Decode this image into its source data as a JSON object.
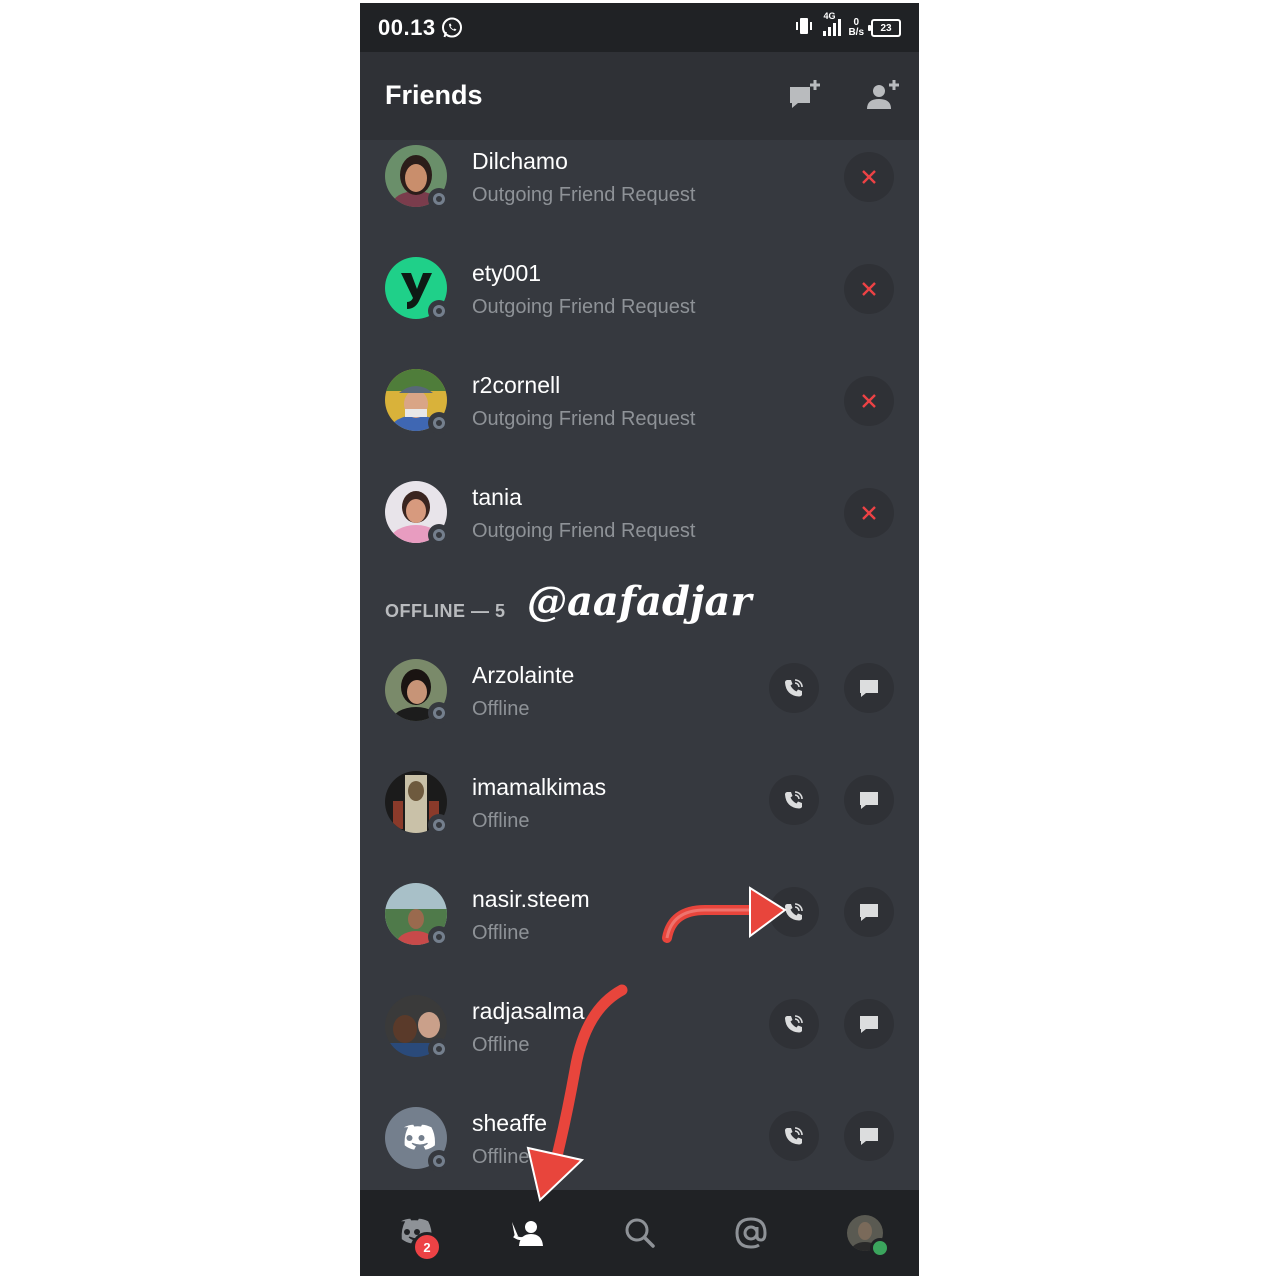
{
  "statusbar": {
    "time": "00.13",
    "network": "4G",
    "speed_value": "0",
    "speed_unit": "B/s",
    "battery": "23"
  },
  "header": {
    "title": "Friends"
  },
  "pending": [
    {
      "name": "Dilchamo",
      "status": "Outgoing Friend Request"
    },
    {
      "name": "ety001",
      "status": "Outgoing Friend Request"
    },
    {
      "name": "r2cornell",
      "status": "Outgoing Friend Request"
    },
    {
      "name": "tania",
      "status": "Outgoing Friend Request"
    }
  ],
  "offline_section": {
    "label": "OFFLINE — 5"
  },
  "watermark": "@aafadjar",
  "offline": [
    {
      "name": "Arzolainte",
      "status": "Offline"
    },
    {
      "name": "imamalkimas",
      "status": "Offline"
    },
    {
      "name": "nasir.steem",
      "status": "Offline"
    },
    {
      "name": "radjasalma",
      "status": "Offline"
    },
    {
      "name": "sheaffe",
      "status": "Offline"
    }
  ],
  "nav": {
    "home_badge": "2"
  },
  "colors": {
    "background": "#36393f",
    "header": "#2f3136",
    "statusbar": "#202225",
    "deny_red": "#ed4245",
    "annotation_red": "#e8453c",
    "online_green": "#3ba55d"
  }
}
